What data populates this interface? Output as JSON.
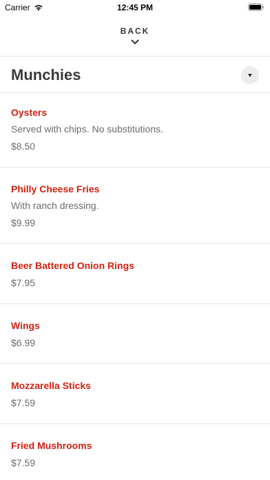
{
  "status_bar": {
    "carrier": "Carrier",
    "time": "12:45 PM"
  },
  "header": {
    "back_label": "BACK"
  },
  "section": {
    "title": "Munchies"
  },
  "menu": {
    "items": [
      {
        "name": "Oysters",
        "description": "Served with chips. No substitutions.",
        "price": "$8.50"
      },
      {
        "name": "Philly Cheese Fries",
        "description": "With ranch dressing.",
        "price": "$9.99"
      },
      {
        "name": "Beer Battered Onion Rings",
        "price": "$7.95"
      },
      {
        "name": "Wings",
        "price": "$6.99"
      },
      {
        "name": "Mozzarella Sticks",
        "price": "$7.59"
      },
      {
        "name": "Fried Mushrooms",
        "price": "$7.59"
      }
    ]
  },
  "colors": {
    "accent": "#d0210e",
    "text_muted": "#6b6b6b",
    "divider": "#e5e5e5"
  }
}
